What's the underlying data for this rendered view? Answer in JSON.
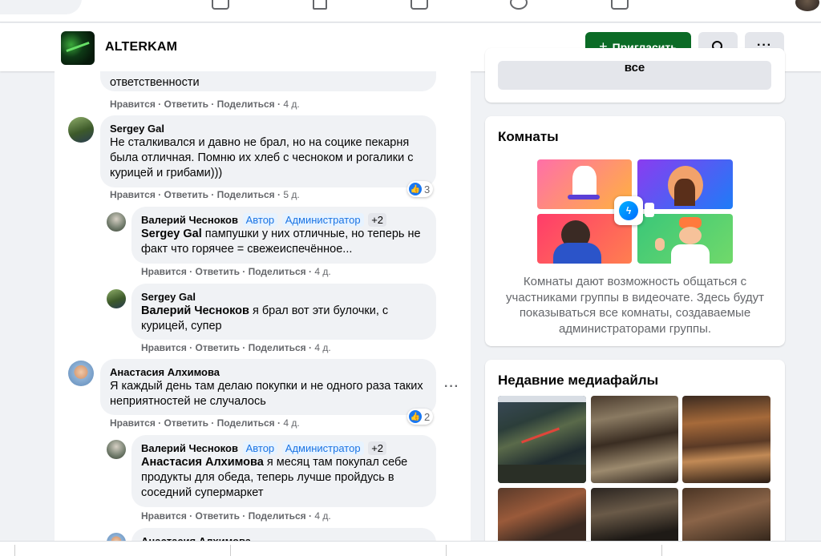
{
  "group": {
    "name": "ALTERKAM",
    "invite_label": "Пригласить",
    "more_label": "···"
  },
  "comments": [
    {
      "text": "ответственности",
      "actions": {
        "like": "Нравится",
        "reply": "Ответить",
        "share": "Поделиться",
        "time": "4 д."
      }
    },
    {
      "author": "Sergey Gal",
      "text": "Не сталкивался и давно не брал, но на социке пекарня была отличная. Помню их хлеб с чесноком и рогалики с курицей и грибами)))",
      "reactions": "3",
      "actions": {
        "like": "Нравится",
        "reply": "Ответить",
        "share": "Поделиться",
        "time": "5 д."
      }
    },
    {
      "author": "Валерий Чесноков",
      "badges": [
        "Автор",
        "Администратор",
        "+2"
      ],
      "mention": "Sergey Gal",
      "text": " пампушки у них отличные, но теперь не факт что горячее = свежеиспечённое...",
      "actions": {
        "like": "Нравится",
        "reply": "Ответить",
        "share": "Поделиться",
        "time": "4 д."
      }
    },
    {
      "author": "Sergey Gal",
      "mention": "Валерий Чесноков",
      "text": " я брал вот эти булочки, с курицей, супер",
      "actions": {
        "like": "Нравится",
        "reply": "Ответить",
        "share": "Поделиться",
        "time": "4 д."
      }
    },
    {
      "author": "Анастасия Алхимова",
      "text": "Я каждый день там делаю покупки и не одного раза таких неприятностей не случалось",
      "reactions": "2",
      "actions": {
        "like": "Нравится",
        "reply": "Ответить",
        "share": "Поделиться",
        "time": "4 д."
      }
    },
    {
      "author": "Валерий Чесноков",
      "badges": [
        "Автор",
        "Администратор",
        "+2"
      ],
      "mention": "Анастасия Алхимова",
      "text": " я месяц там покупал себе продукты для обеда, теперь лучше пройдусь в соседний супермаркет",
      "actions": {
        "like": "Нравится",
        "reply": "Ответить",
        "share": "Поделиться",
        "time": "4 д."
      }
    },
    {
      "author": "Анастасия Алхимова"
    }
  ],
  "sidebar": {
    "see_all_label": "все",
    "rooms": {
      "title": "Комнаты",
      "description": "Комнаты дают возможность общаться с участниками группы в видеочате. Здесь будут показываться все комнаты, создаваемые администраторами группы."
    },
    "media": {
      "title": "Недавние медиафайлы"
    }
  },
  "colors": {
    "primary_green": "#0b6b26",
    "badge_blue": "#1b74e4",
    "like_blue": "#1877f2",
    "bubble_bg": "#f0f2f5"
  }
}
